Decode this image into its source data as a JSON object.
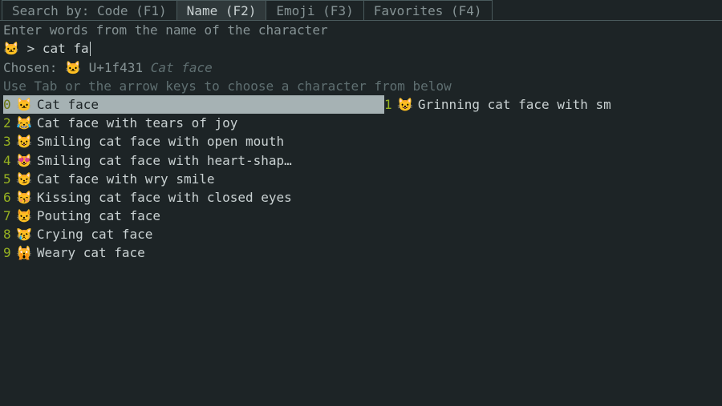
{
  "tabbar": {
    "prefix": "Search by:",
    "tabs": [
      {
        "label": "Code (F1)",
        "active": false
      },
      {
        "label": "Name (F2)",
        "active": true
      },
      {
        "label": "Emoji (F3)",
        "active": false
      },
      {
        "label": "Favorites (F4)",
        "active": false
      }
    ]
  },
  "instruction": "Enter words from the name of the character",
  "prompt": {
    "icon": "🐱",
    "caret": ">",
    "input": "cat fa"
  },
  "chosen": {
    "label": "Chosen:",
    "emoji": "🐱",
    "code": "U+1f431",
    "name": "Cat face"
  },
  "hint": "Use Tab or the arrow keys to choose a character from below",
  "results": [
    {
      "index": "0",
      "emoji": "🐱",
      "name": "Cat face",
      "selected": true
    },
    {
      "index": "1",
      "emoji": "😺",
      "name": "Grinning cat face with sm",
      "selected": false,
      "col": 1
    },
    {
      "index": "2",
      "emoji": "😹",
      "name": "Cat face with tears of joy",
      "selected": false
    },
    {
      "index": "3",
      "emoji": "😺",
      "name": "Smiling cat face with open mouth",
      "selected": false
    },
    {
      "index": "4",
      "emoji": "😻",
      "name": "Smiling cat face with heart-shap…",
      "selected": false
    },
    {
      "index": "5",
      "emoji": "😼",
      "name": "Cat face with wry smile",
      "selected": false
    },
    {
      "index": "6",
      "emoji": "😽",
      "name": "Kissing cat face with closed eyes",
      "selected": false
    },
    {
      "index": "7",
      "emoji": "😾",
      "name": "Pouting cat face",
      "selected": false
    },
    {
      "index": "8",
      "emoji": "😿",
      "name": "Crying cat face",
      "selected": false
    },
    {
      "index": "9",
      "emoji": "🙀",
      "name": "Weary cat face",
      "selected": false
    }
  ]
}
